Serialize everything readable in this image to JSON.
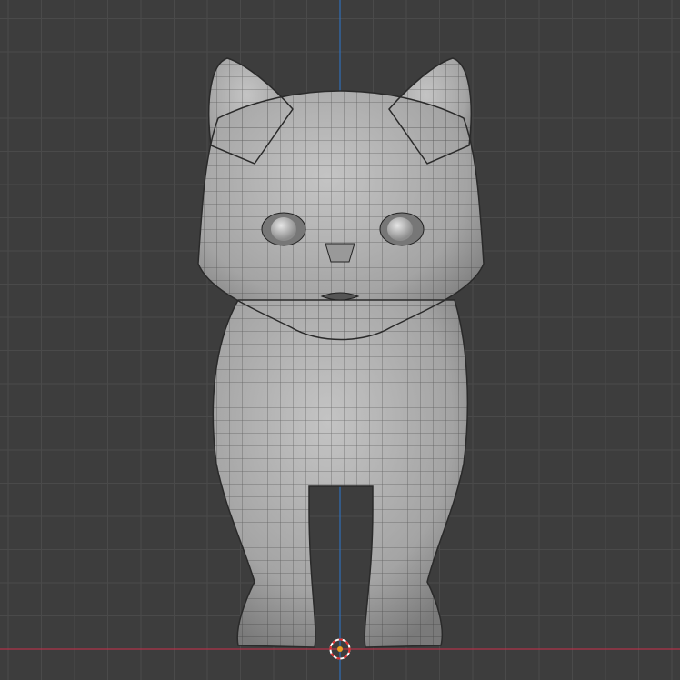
{
  "viewport": {
    "view": "front-orthographic",
    "object": "cat-mesh",
    "overlay": "wireframe",
    "colors": {
      "background": "#3d3d3d",
      "grid": "#4a4a4a",
      "x_axis": "#b0334a",
      "z_axis": "#2f6fb8",
      "mesh": "#a9a9a9",
      "wire": "#1e1e1e",
      "cursor_ring_red": "#e03030",
      "cursor_ring_white": "#ffffff",
      "origin": "#f0a020"
    }
  }
}
